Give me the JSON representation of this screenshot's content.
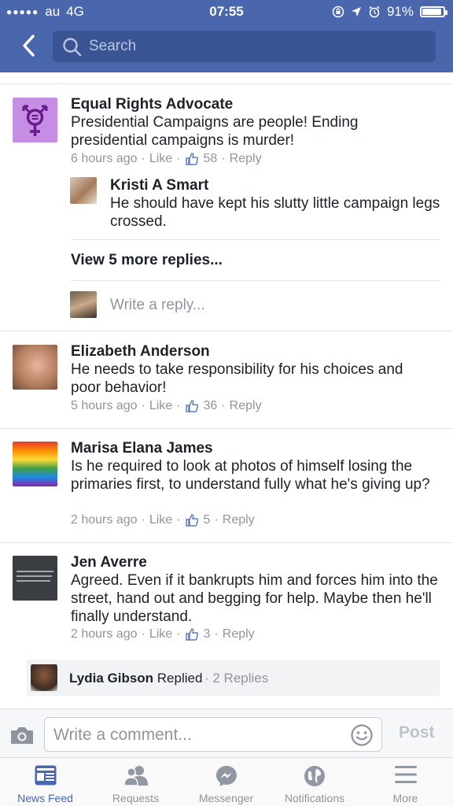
{
  "status_bar": {
    "carrier": "au",
    "network": "4G",
    "time": "07:55",
    "battery": "91%"
  },
  "nav": {
    "search_placeholder": "Search"
  },
  "comments": [
    {
      "name": "Equal Rights Advocate",
      "text": "Presidential Campaigns are people! Ending presidential campaigns is murder!",
      "time": "6 hours ago",
      "like": "Like",
      "likes": "58",
      "reply": "Reply"
    },
    {
      "name": "Elizabeth Anderson",
      "text": "He needs to take responsibility for his choices and poor behavior!",
      "time": "5 hours ago",
      "like": "Like",
      "likes": "36",
      "reply": "Reply"
    },
    {
      "name": "Marisa Elana James",
      "text": "Is he required to look at photos of himself losing the primaries first, to understand fully what he's giving up?",
      "time": "2 hours ago",
      "like": "Like",
      "likes": "5",
      "reply": "Reply"
    },
    {
      "name": "Jen Averre",
      "text": "Agreed. Even if it bankrupts him and forces him into the street, hand out and begging for help. Maybe then he'll finally understand.",
      "time": "2 hours ago",
      "like": "Like",
      "likes": "3",
      "reply": "Reply"
    }
  ],
  "reply": {
    "name": "Kristi A Smart",
    "text": "He should have kept his slutty little campaign legs crossed."
  },
  "view_more": "View 5 more replies...",
  "write_reply_placeholder": "Write a reply...",
  "replied": {
    "name": "Lydia Gibson",
    "verb": "Replied",
    "count": "· 2 Replies"
  },
  "composer": {
    "placeholder": "Write a comment...",
    "post_label": "Post"
  },
  "tabs": [
    {
      "label": "News Feed",
      "icon": "news-feed-icon",
      "active": true
    },
    {
      "label": "Requests",
      "icon": "friend-requests-icon",
      "active": false
    },
    {
      "label": "Messenger",
      "icon": "messenger-icon",
      "active": false
    },
    {
      "label": "Notifications",
      "icon": "globe-icon",
      "active": false
    },
    {
      "label": "More",
      "icon": "menu-icon",
      "active": false
    }
  ],
  "colors": {
    "brand": "#4a67ad",
    "meta_text": "#90949c",
    "active_tab": "#4a67ad"
  }
}
